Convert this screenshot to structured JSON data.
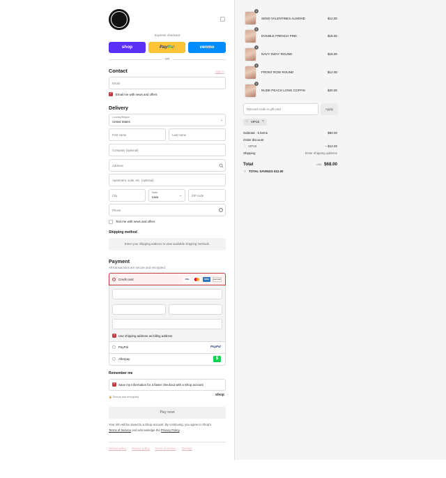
{
  "header": {
    "logo_alt": "store-logo"
  },
  "express": {
    "title": "Express checkout",
    "shop_label": "shop",
    "paypal_label_a": "Pay",
    "paypal_label_b": "Pal",
    "venmo_label": "venmo",
    "or_label": "OR"
  },
  "contact": {
    "title": "Contact",
    "sign_in": "Sign in",
    "email_placeholder": "Email",
    "news_label": "Email me with news and offers"
  },
  "delivery": {
    "title": "Delivery",
    "country_label": "Country/Region",
    "country_value": "United States",
    "first_name": "First name",
    "last_name": "Last name",
    "company": "Company (optional)",
    "address": "Address",
    "apartment": "Apartment, suite, etc. (optional)",
    "city": "City",
    "state_label": "State",
    "state_value": "Iowa",
    "zip": "ZIP code",
    "phone": "Phone",
    "text_news_label": "Text me with news and offers"
  },
  "shipping": {
    "title": "Shipping method",
    "note": "Enter your shipping address to view available shipping methods."
  },
  "payment": {
    "title": "Payment",
    "subtitle": "All transactions are secure and encrypted.",
    "credit_card_label": "Credit card",
    "card_brands": [
      "VISA",
      "MC",
      "AMEX",
      "DISCOVER"
    ],
    "billing_label": "Use shipping address as billing address",
    "paypal_label": "PayPal",
    "paypal_logo": "PayPal",
    "afterpay_label": "Afterpay",
    "afterpay_logo": "$"
  },
  "remember": {
    "title": "Remember me",
    "save_label": "Save my information for a faster checkout with a Shop account",
    "secure_label": "Secure and encrypted",
    "shop_logo": "shop"
  },
  "pay_now_label": "Pay now",
  "legal": {
    "text_1": "Your info will be saved to a Shop account. By continuing, you agree to Shop's",
    "terms": "Terms of Service",
    "text_2": " and acknowledge the ",
    "privacy": "Privacy Policy",
    "text_3": "."
  },
  "footer_links": [
    "Refund policy",
    "Privacy policy",
    "Terms of service",
    "Contact"
  ],
  "cart": {
    "items": [
      {
        "name": "SEND VALENTINES ALMOND",
        "price": "$12.00",
        "qty": "1"
      },
      {
        "name": "DOUBLE FRENCH PINK",
        "price": "$18.00",
        "qty": "1"
      },
      {
        "name": "NAVY SWAY ROUND",
        "price": "$18.00",
        "qty": "1"
      },
      {
        "name": "FRONT ROW ROUND",
        "price": "$12.00",
        "qty": "1"
      },
      {
        "name": "NUDE PEACH LONG COFFIN",
        "price": "$20.00",
        "qty": "1"
      }
    ],
    "discount_placeholder": "Discount code or gift card",
    "apply_label": "Apply",
    "applied_code": "VIP15"
  },
  "summary": {
    "subtotal_label": "Subtotal · 5 items",
    "subtotal_value": "$80.00",
    "order_discount_label": "Order discount",
    "discount_code": "VIP15",
    "discount_value": "– $12.00",
    "shipping_label": "Shipping",
    "shipping_value": "Enter shipping address",
    "total_label": "Total",
    "currency": "USD",
    "total_value": "$68.00",
    "savings_label": "TOTAL SAVINGS",
    "savings_value": "$12.00"
  },
  "colors": {
    "accent": "#c13b42",
    "shop_purple": "#5a31f4",
    "paypal_yellow": "#ffc439",
    "venmo_blue": "#008cff"
  }
}
